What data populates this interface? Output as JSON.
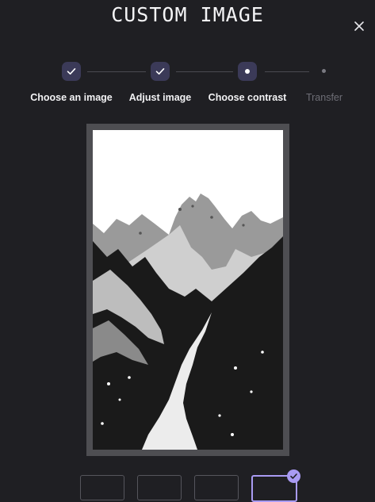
{
  "dialog": {
    "title": "CUSTOM IMAGE",
    "close_icon": "close-icon"
  },
  "stepper": {
    "steps": [
      {
        "label": "Choose an image",
        "state": "completed",
        "icon": "check-icon"
      },
      {
        "label": "Adjust image",
        "state": "completed",
        "icon": "check-icon"
      },
      {
        "label": "Choose contrast",
        "state": "current",
        "icon": "dot-icon"
      },
      {
        "label": "Transfer",
        "state": "pending",
        "icon": "dot-icon"
      }
    ]
  },
  "preview": {
    "subject": "black-and-white mountain trail image",
    "frame_color": "#4e4e52"
  },
  "contrast_options": {
    "count": 4,
    "selected_index": 3
  },
  "colors": {
    "background": "#1f1f23",
    "step_circle": "#3b3a58",
    "accent": "#a99bf3",
    "pending_text": "#6e6e76"
  }
}
